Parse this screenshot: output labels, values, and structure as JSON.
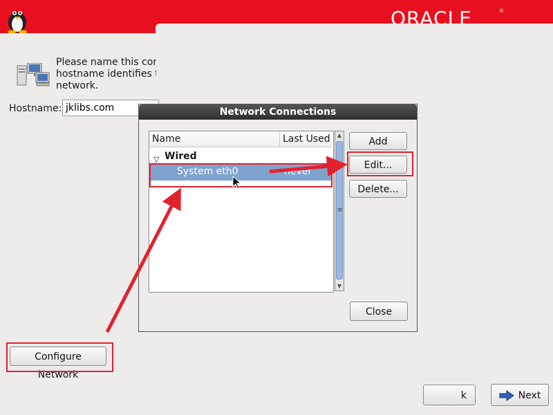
{
  "brand": {
    "logo_text": "ORACLE",
    "logo_mark": "®",
    "colors": {
      "banner": "#e8101f",
      "selection": "#7ea3cf",
      "annotation": "#e3222f"
    }
  },
  "intro": {
    "text": "Please name this com\nhostname identifies th\nnetwork."
  },
  "hostname": {
    "label": "Hostname:",
    "value": "jklibs.com"
  },
  "dialog": {
    "title": "Network Connections",
    "columns": {
      "name": "Name",
      "last_used": "Last Used"
    },
    "group": {
      "label": "Wired"
    },
    "connection": {
      "name": "System eth0",
      "last_used": "never"
    },
    "buttons": {
      "add": "Add",
      "edit": "Edit...",
      "delete": "Delete...",
      "close": "Close"
    }
  },
  "footer": {
    "configure_network": "Configure Network",
    "back": "k",
    "next": "Next"
  },
  "icons": {
    "tux": "tux-logo-icon",
    "host": "network-computers-icon",
    "next": "arrow-right-icon",
    "cursor": "mouse-cursor-icon"
  }
}
